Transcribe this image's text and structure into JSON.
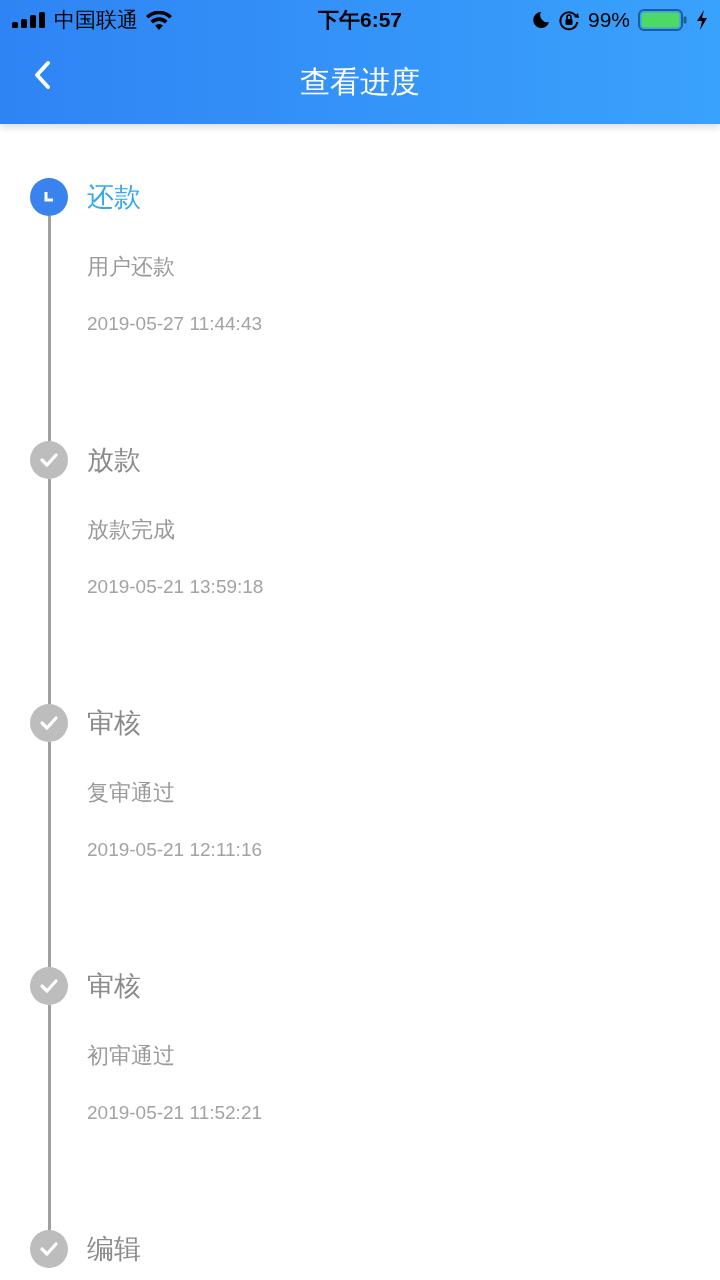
{
  "status_bar": {
    "carrier": "中国联通",
    "time": "下午6:57",
    "battery": "99%"
  },
  "nav": {
    "title": "查看进度"
  },
  "steps": [
    {
      "title": "还款",
      "description": "用户还款",
      "time": "2019-05-27 11:44:43",
      "kind": "current"
    },
    {
      "title": "放款",
      "description": "放款完成",
      "time": "2019-05-21 13:59:18",
      "kind": "done"
    },
    {
      "title": "审核",
      "description": "复审通过",
      "time": "2019-05-21 12:11:16",
      "kind": "done"
    },
    {
      "title": "审核",
      "description": "初审通过",
      "time": "2019-05-21 11:52:21",
      "kind": "done"
    },
    {
      "title": "编辑",
      "kind": "done"
    }
  ]
}
